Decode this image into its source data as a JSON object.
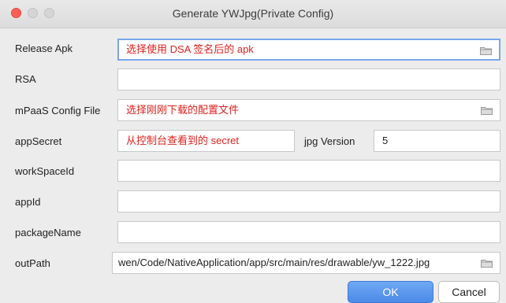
{
  "window": {
    "title": "Generate YWJpg(Private Config)"
  },
  "form": {
    "release_apk": {
      "label": "Release Apk",
      "value": "选择使用 DSA 签名后的 apk"
    },
    "rsa": {
      "label": "RSA",
      "value": ""
    },
    "mpaas_config": {
      "label": "mPaaS Config File",
      "value": "选择刚刚下载的配置文件"
    },
    "app_secret": {
      "label": "appSecret",
      "value": "从控制台查看到的 secret"
    },
    "jpg_version": {
      "label": "jpg Version",
      "value": "5"
    },
    "workspace_id": {
      "label": "workSpaceId",
      "value": ""
    },
    "app_id": {
      "label": "appId",
      "value": ""
    },
    "package_name": {
      "label": "packageName",
      "value": ""
    },
    "out_path": {
      "label": "outPath",
      "value": "wen/Code/NativeApplication/app/src/main/res/drawable/yw_1222.jpg"
    }
  },
  "buttons": {
    "ok": "OK",
    "cancel": "Cancel"
  },
  "icons": {
    "folder": "folder-icon"
  },
  "colors": {
    "annotation_red": "#e0211d",
    "focus_blue": "#7aa7e9",
    "ok_blue": "#4a8ae8"
  }
}
